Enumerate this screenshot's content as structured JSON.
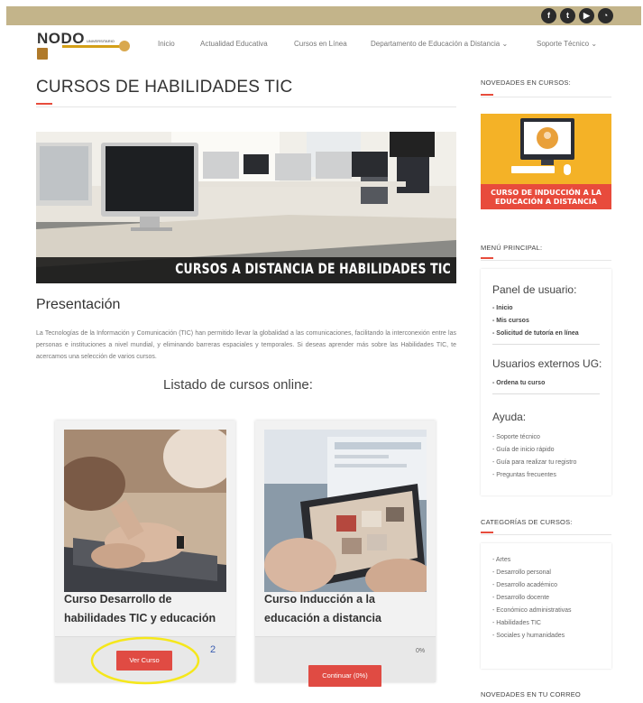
{
  "header": {
    "logo_text": "NODO",
    "logo_sub": "UNIVERSITARIO",
    "social_icons": [
      "facebook-icon",
      "twitter-icon",
      "youtube-icon",
      "rss-icon"
    ],
    "nav": [
      "Inicio",
      "Actualidad Educativa",
      "Cursos en Línea",
      "Departamento de Educación a Distancia",
      "Soporte Técnico"
    ]
  },
  "main": {
    "title": "CURSOS DE HABILIDADES TIC",
    "banner_caption": "CURSOS A DISTANCIA DE HABILIDADES TIC",
    "section_heading": "Presentación",
    "paragraph": "La Tecnologías de la Información y Comunicación (TIC) han permitido llevar la globalidad a las comunicaciones, facilitando la interconexión entre las personas e instituciones a nivel mundial, y eliminando barreras espaciales y temporales. Si deseas aprender más sobre las Habilidades TIC, te acercamos una selección de varios cursos.",
    "listing_heading": "Listado de cursos online:",
    "courses": [
      {
        "title": "Curso Desarrollo de habilidades TIC y educación",
        "button": "Ver Curso",
        "annotation": "2"
      },
      {
        "title": "Curso Inducción a la educación a distancia",
        "button": "Continuar (0%)",
        "progress_label": "0%"
      }
    ]
  },
  "sidebar": {
    "news_heading": "NOVEDADES EN CURSOS:",
    "promo_text": "CURSO DE INDUCCIÓN A LA EDUCACIÓN A DISTANCIA",
    "menu_heading": "MENÚ PRINCIPAL:",
    "panel_title": "Panel de usuario:",
    "panel_items": [
      "- Inicio",
      "- Mis cursos",
      "- Solicitud de tutoría en línea"
    ],
    "external_title": "Usuarios externos UG:",
    "external_items": [
      "- Ordena tu curso"
    ],
    "help_title": "Ayuda:",
    "help_items": [
      "- Soporte técnico",
      "- Guía de inicio rápido",
      "- Guía para realizar tu registro",
      "- Preguntas frecuentes"
    ],
    "categories_heading": "CATEGORÍAS DE CURSOS:",
    "categories": [
      "- Artes",
      "- Desarrollo personal",
      "- Desarrollo académico",
      "- Desarrollo docente",
      "- Económico administrativas",
      "- Habilidades TIC",
      "- Sociales y humanidades"
    ],
    "email_heading": "NOVEDADES EN TU CORREO"
  },
  "colors": {
    "accent": "#e74c3c",
    "topbar": "#c3b48a",
    "button": "#e04b43",
    "highlight": "#f5e71b"
  }
}
